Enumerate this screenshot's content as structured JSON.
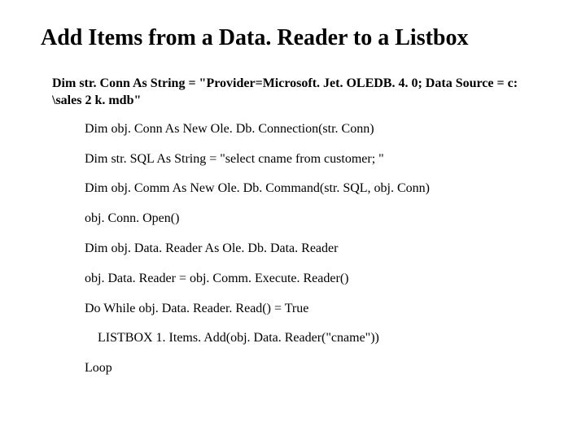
{
  "title": "Add Items from a Data. Reader to a Listbox",
  "subheading": "Dim str. Conn As String = \"Provider=Microsoft. Jet. OLEDB. 4. 0; Data Source = c: \\sales 2 k. mdb\"",
  "lines": [
    "Dim obj. Conn As New Ole. Db. Connection(str. Conn)",
    "Dim str. SQL As String = \"select cname from customer; \"",
    "Dim obj. Comm As New Ole. Db. Command(str. SQL, obj. Conn)",
    "obj. Conn. Open()",
    "Dim obj. Data. Reader As Ole. Db. Data. Reader",
    "obj. Data. Reader = obj. Comm. Execute. Reader()",
    "Do While obj. Data. Reader. Read() = True"
  ],
  "indented_line": "LISTBOX 1. Items. Add(obj. Data. Reader(\"cname\"))",
  "last_line": "Loop"
}
